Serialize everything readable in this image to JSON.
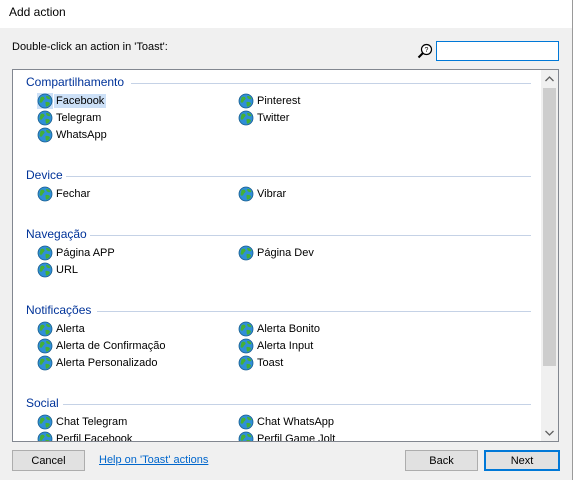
{
  "window": {
    "title": "Add action"
  },
  "prompt": "Double-click an action in 'Toast':",
  "search": {
    "value": "",
    "placeholder": ""
  },
  "sections": [
    {
      "header": "Compartilhamento",
      "items": [
        {
          "label": "Facebook",
          "selected": true
        },
        {
          "label": "Pinterest"
        },
        {
          "label": "Telegram"
        },
        {
          "label": "Twitter"
        },
        {
          "label": "WhatsApp"
        }
      ]
    },
    {
      "header": "Device",
      "items": [
        {
          "label": "Fechar"
        },
        {
          "label": "Vibrar"
        }
      ]
    },
    {
      "header": "Navegação",
      "items": [
        {
          "label": "Página APP"
        },
        {
          "label": "Página Dev"
        },
        {
          "label": "URL"
        }
      ]
    },
    {
      "header": "Notificações",
      "items": [
        {
          "label": "Alerta"
        },
        {
          "label": "Alerta Bonito"
        },
        {
          "label": "Alerta de Confirmação"
        },
        {
          "label": "Alerta Input"
        },
        {
          "label": "Alerta Personalizado"
        },
        {
          "label": "Toast"
        }
      ]
    },
    {
      "header": "Social",
      "items": [
        {
          "label": "Chat Telegram"
        },
        {
          "label": "Chat WhatsApp"
        },
        {
          "label": "Perfil Facebook"
        },
        {
          "label": "Perfil Game Jolt"
        }
      ]
    }
  ],
  "buttons": {
    "cancel": "Cancel",
    "help": "Help on 'Toast' actions",
    "back": "Back",
    "next": "Next"
  },
  "colors": {
    "accent": "#0078d7",
    "section_header": "#003399",
    "selection": "#cce0f7"
  },
  "icons": {
    "item": "globe-icon",
    "search": "search-help-icon"
  }
}
